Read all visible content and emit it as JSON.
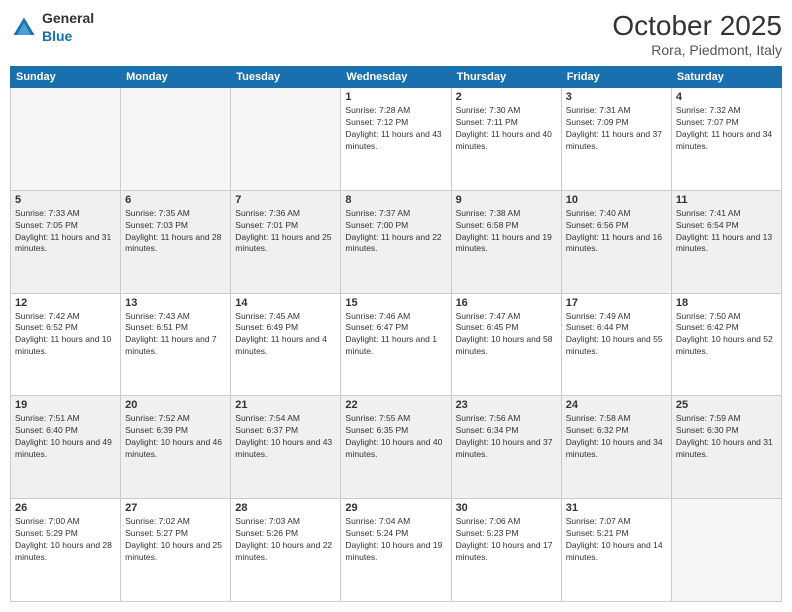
{
  "header": {
    "logo_general": "General",
    "logo_blue": "Blue",
    "title": "October 2025",
    "location": "Rora, Piedmont, Italy"
  },
  "days": [
    "Sunday",
    "Monday",
    "Tuesday",
    "Wednesday",
    "Thursday",
    "Friday",
    "Saturday"
  ],
  "weeks": [
    [
      {
        "date": "",
        "info": ""
      },
      {
        "date": "",
        "info": ""
      },
      {
        "date": "",
        "info": ""
      },
      {
        "date": "1",
        "info": "Sunrise: 7:28 AM\nSunset: 7:12 PM\nDaylight: 11 hours and 43 minutes."
      },
      {
        "date": "2",
        "info": "Sunrise: 7:30 AM\nSunset: 7:11 PM\nDaylight: 11 hours and 40 minutes."
      },
      {
        "date": "3",
        "info": "Sunrise: 7:31 AM\nSunset: 7:09 PM\nDaylight: 11 hours and 37 minutes."
      },
      {
        "date": "4",
        "info": "Sunrise: 7:32 AM\nSunset: 7:07 PM\nDaylight: 11 hours and 34 minutes."
      }
    ],
    [
      {
        "date": "5",
        "info": "Sunrise: 7:33 AM\nSunset: 7:05 PM\nDaylight: 11 hours and 31 minutes."
      },
      {
        "date": "6",
        "info": "Sunrise: 7:35 AM\nSunset: 7:03 PM\nDaylight: 11 hours and 28 minutes."
      },
      {
        "date": "7",
        "info": "Sunrise: 7:36 AM\nSunset: 7:01 PM\nDaylight: 11 hours and 25 minutes."
      },
      {
        "date": "8",
        "info": "Sunrise: 7:37 AM\nSunset: 7:00 PM\nDaylight: 11 hours and 22 minutes."
      },
      {
        "date": "9",
        "info": "Sunrise: 7:38 AM\nSunset: 6:58 PM\nDaylight: 11 hours and 19 minutes."
      },
      {
        "date": "10",
        "info": "Sunrise: 7:40 AM\nSunset: 6:56 PM\nDaylight: 11 hours and 16 minutes."
      },
      {
        "date": "11",
        "info": "Sunrise: 7:41 AM\nSunset: 6:54 PM\nDaylight: 11 hours and 13 minutes."
      }
    ],
    [
      {
        "date": "12",
        "info": "Sunrise: 7:42 AM\nSunset: 6:52 PM\nDaylight: 11 hours and 10 minutes."
      },
      {
        "date": "13",
        "info": "Sunrise: 7:43 AM\nSunset: 6:51 PM\nDaylight: 11 hours and 7 minutes."
      },
      {
        "date": "14",
        "info": "Sunrise: 7:45 AM\nSunset: 6:49 PM\nDaylight: 11 hours and 4 minutes."
      },
      {
        "date": "15",
        "info": "Sunrise: 7:46 AM\nSunset: 6:47 PM\nDaylight: 11 hours and 1 minute."
      },
      {
        "date": "16",
        "info": "Sunrise: 7:47 AM\nSunset: 6:45 PM\nDaylight: 10 hours and 58 minutes."
      },
      {
        "date": "17",
        "info": "Sunrise: 7:49 AM\nSunset: 6:44 PM\nDaylight: 10 hours and 55 minutes."
      },
      {
        "date": "18",
        "info": "Sunrise: 7:50 AM\nSunset: 6:42 PM\nDaylight: 10 hours and 52 minutes."
      }
    ],
    [
      {
        "date": "19",
        "info": "Sunrise: 7:51 AM\nSunset: 6:40 PM\nDaylight: 10 hours and 49 minutes."
      },
      {
        "date": "20",
        "info": "Sunrise: 7:52 AM\nSunset: 6:39 PM\nDaylight: 10 hours and 46 minutes."
      },
      {
        "date": "21",
        "info": "Sunrise: 7:54 AM\nSunset: 6:37 PM\nDaylight: 10 hours and 43 minutes."
      },
      {
        "date": "22",
        "info": "Sunrise: 7:55 AM\nSunset: 6:35 PM\nDaylight: 10 hours and 40 minutes."
      },
      {
        "date": "23",
        "info": "Sunrise: 7:56 AM\nSunset: 6:34 PM\nDaylight: 10 hours and 37 minutes."
      },
      {
        "date": "24",
        "info": "Sunrise: 7:58 AM\nSunset: 6:32 PM\nDaylight: 10 hours and 34 minutes."
      },
      {
        "date": "25",
        "info": "Sunrise: 7:59 AM\nSunset: 6:30 PM\nDaylight: 10 hours and 31 minutes."
      }
    ],
    [
      {
        "date": "26",
        "info": "Sunrise: 7:00 AM\nSunset: 5:29 PM\nDaylight: 10 hours and 28 minutes."
      },
      {
        "date": "27",
        "info": "Sunrise: 7:02 AM\nSunset: 5:27 PM\nDaylight: 10 hours and 25 minutes."
      },
      {
        "date": "28",
        "info": "Sunrise: 7:03 AM\nSunset: 5:26 PM\nDaylight: 10 hours and 22 minutes."
      },
      {
        "date": "29",
        "info": "Sunrise: 7:04 AM\nSunset: 5:24 PM\nDaylight: 10 hours and 19 minutes."
      },
      {
        "date": "30",
        "info": "Sunrise: 7:06 AM\nSunset: 5:23 PM\nDaylight: 10 hours and 17 minutes."
      },
      {
        "date": "31",
        "info": "Sunrise: 7:07 AM\nSunset: 5:21 PM\nDaylight: 10 hours and 14 minutes."
      },
      {
        "date": "",
        "info": ""
      }
    ]
  ]
}
